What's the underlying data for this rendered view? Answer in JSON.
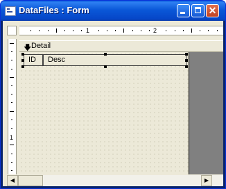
{
  "window": {
    "title": "DataFiles : Form",
    "icon": "form-icon"
  },
  "ruler": {
    "h_labels": [
      "1",
      "2"
    ],
    "v_labels": [
      "1"
    ]
  },
  "section": {
    "label": "Detail",
    "icon": "section-arrow-icon"
  },
  "fields": [
    {
      "label": "ID"
    },
    {
      "label": "Desc"
    }
  ],
  "scrollbar": {
    "left_arrow": "◀",
    "right_arrow": "▶"
  },
  "colors": {
    "titlebar": "#0a58d8",
    "workspace": "#808080",
    "canvas": "#ece9d8"
  }
}
